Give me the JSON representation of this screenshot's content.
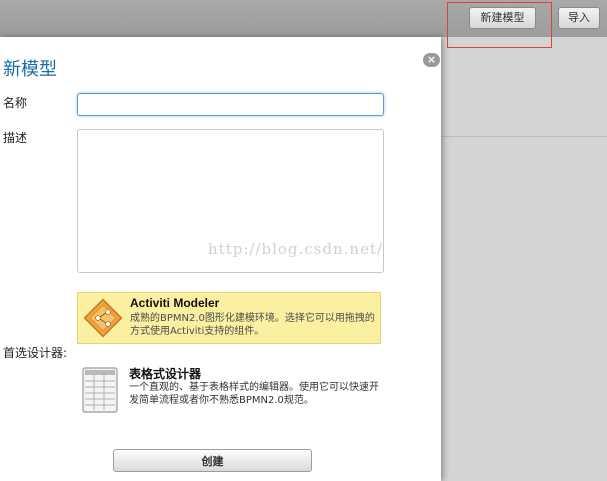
{
  "toolbar": {
    "new_model_label": "新建模型",
    "import_label": "导入"
  },
  "dialog": {
    "title": "新模型",
    "close_glyph": "×",
    "name_label": "名称",
    "name_value": "",
    "description_label": "描述",
    "description_value": "",
    "designer_label": "首选设计器:",
    "options": [
      {
        "icon": "activiti-modeler-icon",
        "title": "Activiti Modeler",
        "description": "成熟的BPMN2.0图形化建模环境。选择它可以用拖拽的方式使用Activiti支持的组件。"
      },
      {
        "icon": "table-designer-icon",
        "title": "表格式设计器",
        "description": "一个直观的、基于表格样式的编辑器。使用它可以快速开发简单流程或者你不熟悉BPMN2.0规范。"
      }
    ],
    "create_label": "创建"
  },
  "watermark": "http://blog.csdn.net/",
  "colors": {
    "title": "#1a6aa8",
    "highlight_box": "#e0413a",
    "activiti_option_bg": "#fbf0a2"
  }
}
